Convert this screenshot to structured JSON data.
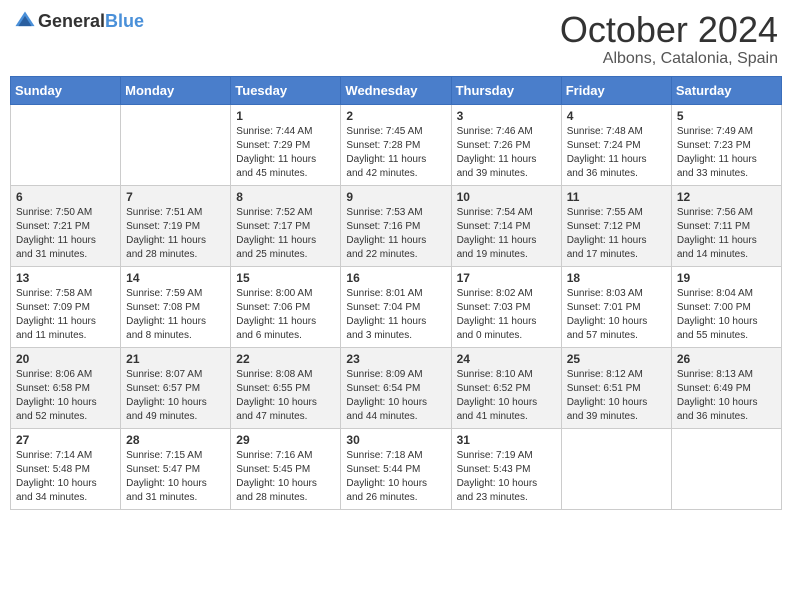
{
  "header": {
    "logo_general": "General",
    "logo_blue": "Blue",
    "month": "October 2024",
    "location": "Albons, Catalonia, Spain"
  },
  "weekdays": [
    "Sunday",
    "Monday",
    "Tuesday",
    "Wednesday",
    "Thursday",
    "Friday",
    "Saturday"
  ],
  "weeks": [
    [
      {
        "day": "",
        "sunrise": "",
        "sunset": "",
        "daylight": ""
      },
      {
        "day": "",
        "sunrise": "",
        "sunset": "",
        "daylight": ""
      },
      {
        "day": "1",
        "sunrise": "Sunrise: 7:44 AM",
        "sunset": "Sunset: 7:29 PM",
        "daylight": "Daylight: 11 hours and 45 minutes."
      },
      {
        "day": "2",
        "sunrise": "Sunrise: 7:45 AM",
        "sunset": "Sunset: 7:28 PM",
        "daylight": "Daylight: 11 hours and 42 minutes."
      },
      {
        "day": "3",
        "sunrise": "Sunrise: 7:46 AM",
        "sunset": "Sunset: 7:26 PM",
        "daylight": "Daylight: 11 hours and 39 minutes."
      },
      {
        "day": "4",
        "sunrise": "Sunrise: 7:48 AM",
        "sunset": "Sunset: 7:24 PM",
        "daylight": "Daylight: 11 hours and 36 minutes."
      },
      {
        "day": "5",
        "sunrise": "Sunrise: 7:49 AM",
        "sunset": "Sunset: 7:23 PM",
        "daylight": "Daylight: 11 hours and 33 minutes."
      }
    ],
    [
      {
        "day": "6",
        "sunrise": "Sunrise: 7:50 AM",
        "sunset": "Sunset: 7:21 PM",
        "daylight": "Daylight: 11 hours and 31 minutes."
      },
      {
        "day": "7",
        "sunrise": "Sunrise: 7:51 AM",
        "sunset": "Sunset: 7:19 PM",
        "daylight": "Daylight: 11 hours and 28 minutes."
      },
      {
        "day": "8",
        "sunrise": "Sunrise: 7:52 AM",
        "sunset": "Sunset: 7:17 PM",
        "daylight": "Daylight: 11 hours and 25 minutes."
      },
      {
        "day": "9",
        "sunrise": "Sunrise: 7:53 AM",
        "sunset": "Sunset: 7:16 PM",
        "daylight": "Daylight: 11 hours and 22 minutes."
      },
      {
        "day": "10",
        "sunrise": "Sunrise: 7:54 AM",
        "sunset": "Sunset: 7:14 PM",
        "daylight": "Daylight: 11 hours and 19 minutes."
      },
      {
        "day": "11",
        "sunrise": "Sunrise: 7:55 AM",
        "sunset": "Sunset: 7:12 PM",
        "daylight": "Daylight: 11 hours and 17 minutes."
      },
      {
        "day": "12",
        "sunrise": "Sunrise: 7:56 AM",
        "sunset": "Sunset: 7:11 PM",
        "daylight": "Daylight: 11 hours and 14 minutes."
      }
    ],
    [
      {
        "day": "13",
        "sunrise": "Sunrise: 7:58 AM",
        "sunset": "Sunset: 7:09 PM",
        "daylight": "Daylight: 11 hours and 11 minutes."
      },
      {
        "day": "14",
        "sunrise": "Sunrise: 7:59 AM",
        "sunset": "Sunset: 7:08 PM",
        "daylight": "Daylight: 11 hours and 8 minutes."
      },
      {
        "day": "15",
        "sunrise": "Sunrise: 8:00 AM",
        "sunset": "Sunset: 7:06 PM",
        "daylight": "Daylight: 11 hours and 6 minutes."
      },
      {
        "day": "16",
        "sunrise": "Sunrise: 8:01 AM",
        "sunset": "Sunset: 7:04 PM",
        "daylight": "Daylight: 11 hours and 3 minutes."
      },
      {
        "day": "17",
        "sunrise": "Sunrise: 8:02 AM",
        "sunset": "Sunset: 7:03 PM",
        "daylight": "Daylight: 11 hours and 0 minutes."
      },
      {
        "day": "18",
        "sunrise": "Sunrise: 8:03 AM",
        "sunset": "Sunset: 7:01 PM",
        "daylight": "Daylight: 10 hours and 57 minutes."
      },
      {
        "day": "19",
        "sunrise": "Sunrise: 8:04 AM",
        "sunset": "Sunset: 7:00 PM",
        "daylight": "Daylight: 10 hours and 55 minutes."
      }
    ],
    [
      {
        "day": "20",
        "sunrise": "Sunrise: 8:06 AM",
        "sunset": "Sunset: 6:58 PM",
        "daylight": "Daylight: 10 hours and 52 minutes."
      },
      {
        "day": "21",
        "sunrise": "Sunrise: 8:07 AM",
        "sunset": "Sunset: 6:57 PM",
        "daylight": "Daylight: 10 hours and 49 minutes."
      },
      {
        "day": "22",
        "sunrise": "Sunrise: 8:08 AM",
        "sunset": "Sunset: 6:55 PM",
        "daylight": "Daylight: 10 hours and 47 minutes."
      },
      {
        "day": "23",
        "sunrise": "Sunrise: 8:09 AM",
        "sunset": "Sunset: 6:54 PM",
        "daylight": "Daylight: 10 hours and 44 minutes."
      },
      {
        "day": "24",
        "sunrise": "Sunrise: 8:10 AM",
        "sunset": "Sunset: 6:52 PM",
        "daylight": "Daylight: 10 hours and 41 minutes."
      },
      {
        "day": "25",
        "sunrise": "Sunrise: 8:12 AM",
        "sunset": "Sunset: 6:51 PM",
        "daylight": "Daylight: 10 hours and 39 minutes."
      },
      {
        "day": "26",
        "sunrise": "Sunrise: 8:13 AM",
        "sunset": "Sunset: 6:49 PM",
        "daylight": "Daylight: 10 hours and 36 minutes."
      }
    ],
    [
      {
        "day": "27",
        "sunrise": "Sunrise: 7:14 AM",
        "sunset": "Sunset: 5:48 PM",
        "daylight": "Daylight: 10 hours and 34 minutes."
      },
      {
        "day": "28",
        "sunrise": "Sunrise: 7:15 AM",
        "sunset": "Sunset: 5:47 PM",
        "daylight": "Daylight: 10 hours and 31 minutes."
      },
      {
        "day": "29",
        "sunrise": "Sunrise: 7:16 AM",
        "sunset": "Sunset: 5:45 PM",
        "daylight": "Daylight: 10 hours and 28 minutes."
      },
      {
        "day": "30",
        "sunrise": "Sunrise: 7:18 AM",
        "sunset": "Sunset: 5:44 PM",
        "daylight": "Daylight: 10 hours and 26 minutes."
      },
      {
        "day": "31",
        "sunrise": "Sunrise: 7:19 AM",
        "sunset": "Sunset: 5:43 PM",
        "daylight": "Daylight: 10 hours and 23 minutes."
      },
      {
        "day": "",
        "sunrise": "",
        "sunset": "",
        "daylight": ""
      },
      {
        "day": "",
        "sunrise": "",
        "sunset": "",
        "daylight": ""
      }
    ]
  ]
}
